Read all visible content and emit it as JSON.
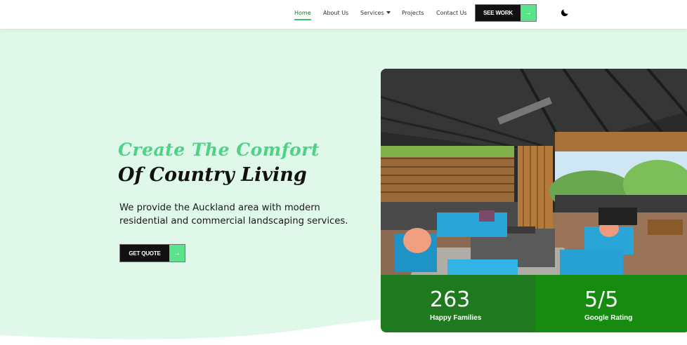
{
  "nav": {
    "items": [
      {
        "label": "Home",
        "active": true
      },
      {
        "label": "About Us"
      },
      {
        "label": "Services",
        "has_dropdown": true
      },
      {
        "label": "Projects"
      },
      {
        "label": "Contact Us"
      }
    ],
    "cta_label": "SEE WORK"
  },
  "hero": {
    "headline_line1": "Create The Comfort",
    "headline_line2": "Of Country Living",
    "description": "We provide the Auckland area with modern residential and commercial landscaping services.",
    "cta_label": "GET QUOTE"
  },
  "stats": [
    {
      "value": "263",
      "label": "Happy Families"
    },
    {
      "value": "5/5",
      "label": "Google Rating"
    }
  ],
  "icons": {
    "theme_toggle": "moon-icon",
    "button_arrow": "arrow-right-icon"
  },
  "colors": {
    "accent_green": "#4cd384",
    "arrow_green": "#5ae38a",
    "hero_bg": "#dff8ea",
    "stat_green": "#1f7a1f"
  }
}
